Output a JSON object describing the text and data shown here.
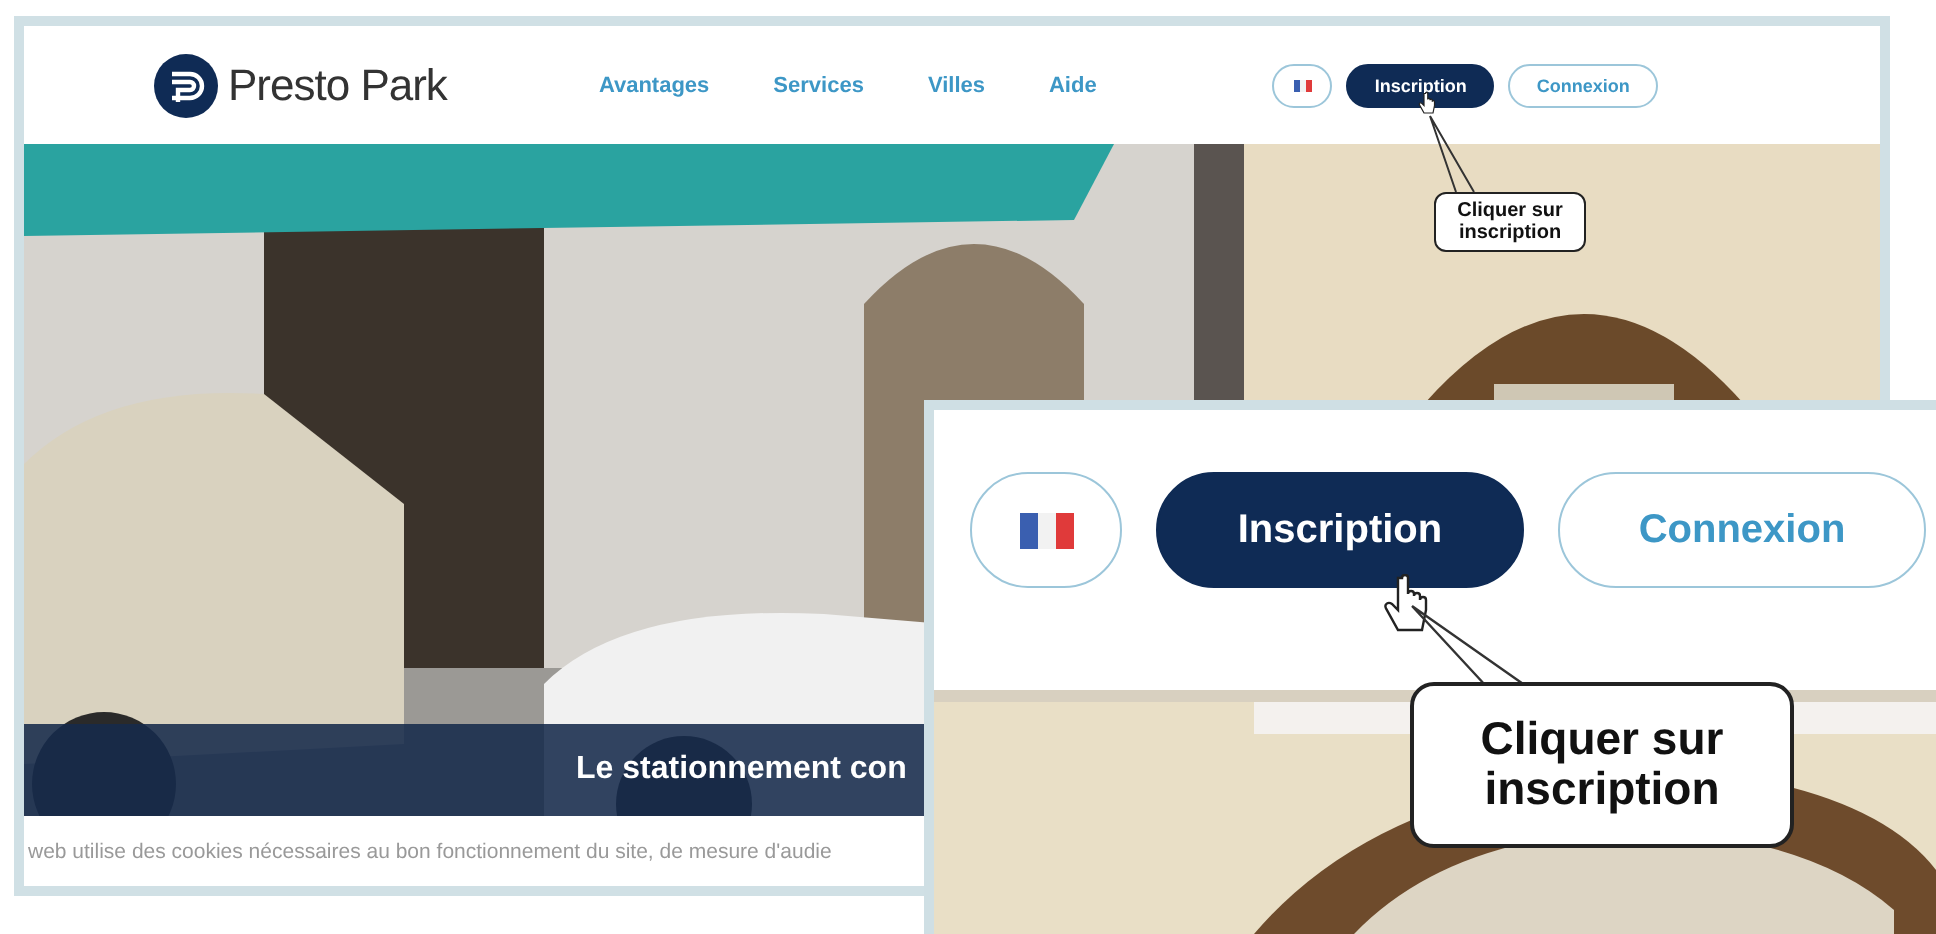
{
  "header": {
    "brand": "Presto Park",
    "nav": [
      "Avantages",
      "Services",
      "Villes",
      "Aide"
    ],
    "buttons": [
      {
        "label": "Inscription",
        "kind": "primary"
      },
      {
        "label": "Connexion",
        "kind": "outline"
      }
    ],
    "callout": "Cliquer sur inscription"
  },
  "hero": {
    "banner": "Le stationnement con"
  },
  "cookie_notice": "web utilise des cookies nécessaires au bon fonctionnement du site, de mesure d'audie",
  "zoom_inset": {
    "buttons": [
      {
        "label": "Inscription",
        "kind": "primary"
      },
      {
        "label": "Connexion",
        "kind": "outline"
      }
    ],
    "callout": "Cliquer sur inscription"
  }
}
